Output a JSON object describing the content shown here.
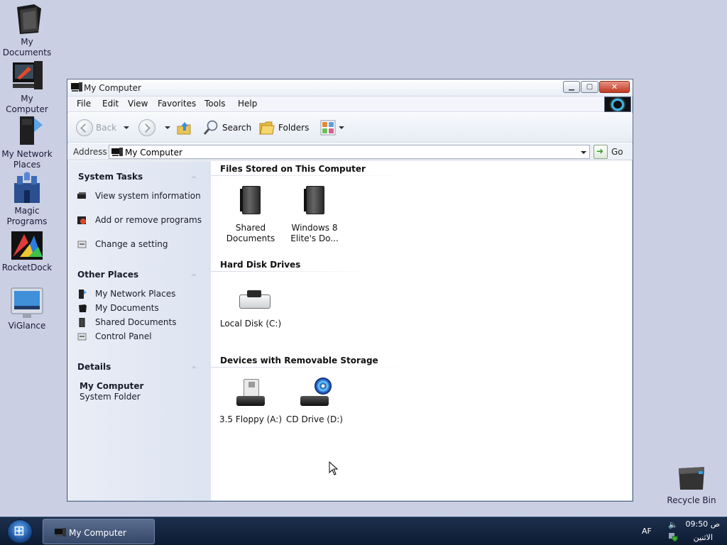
{
  "desktop": {
    "icons": [
      {
        "label": "My Documents"
      },
      {
        "label": "My Computer"
      },
      {
        "label": "My Network Places"
      },
      {
        "label": "Magic Programs"
      },
      {
        "label": "RocketDock"
      },
      {
        "label": "ViGlance"
      },
      {
        "label": "Recycle Bin"
      }
    ]
  },
  "window": {
    "title": "My Computer",
    "menu": [
      "File",
      "Edit",
      "View",
      "Favorites",
      "Tools",
      "Help"
    ],
    "toolbar": {
      "back": "Back",
      "search": "Search",
      "folders": "Folders"
    },
    "address": {
      "label": "Address",
      "value": "My Computer",
      "go": "Go"
    },
    "taskpane": {
      "system_tasks": {
        "title": "System Tasks",
        "items": [
          "View system information",
          "Add or remove programs",
          "Change a setting"
        ]
      },
      "other_places": {
        "title": "Other Places",
        "items": [
          "My Network Places",
          "My Documents",
          "Shared Documents",
          "Control Panel"
        ]
      },
      "details": {
        "title": "Details",
        "name": "My Computer",
        "type": "System Folder"
      }
    },
    "groups": {
      "files": {
        "title": "Files Stored on This Computer",
        "items": [
          "Shared Documents",
          "Windows 8 Elite's Do..."
        ]
      },
      "hdd": {
        "title": "Hard Disk Drives",
        "items": [
          "Local Disk (C:)"
        ]
      },
      "removable": {
        "title": "Devices with Removable Storage",
        "items": [
          "3.5 Floppy (A:)",
          "CD Drive (D:)"
        ]
      }
    }
  },
  "taskbar": {
    "task": "My Computer",
    "language": "AF",
    "time": "09:50 ص",
    "day": "الاثنين"
  },
  "colors": {
    "desktop": "#cbcfe3",
    "taskbar": "#0e1c33",
    "taskpane": "#e2e8f3"
  }
}
